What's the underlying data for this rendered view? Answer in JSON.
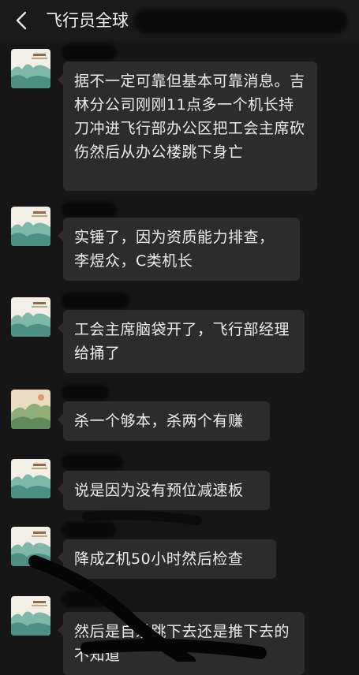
{
  "header": {
    "title": "飞行员全球",
    "back_icon": "chevron-left-icon"
  },
  "messages": [
    {
      "text": "据不一定可靠但基本可靠消息。吉林分公司刚刚11点多一个机长持刀冲进飞行部办公区把工会主席砍伤然后从办公楼跳下身亡",
      "avatar": "landscape-card"
    },
    {
      "text": "实锤了，因为资质能力排查，李煜众，C类机长",
      "avatar": "landscape-card"
    },
    {
      "text": "工会主席脑袋开了，飞行部经理给捅了",
      "avatar": "landscape-card"
    },
    {
      "text": "杀一个够本，杀两个有赚",
      "avatar": "landscape-painting"
    },
    {
      "text": "说是因为没有预位减速板",
      "avatar": "landscape-card"
    },
    {
      "text": "降成Z机50小时然后检查",
      "avatar": "landscape-card"
    },
    {
      "text": "然后是自杀跳下去还是推下去的不知道",
      "avatar": "landscape-card"
    }
  ],
  "colors": {
    "background": "#161616",
    "bubble": "#2c2c2c",
    "text": "#ececec"
  }
}
